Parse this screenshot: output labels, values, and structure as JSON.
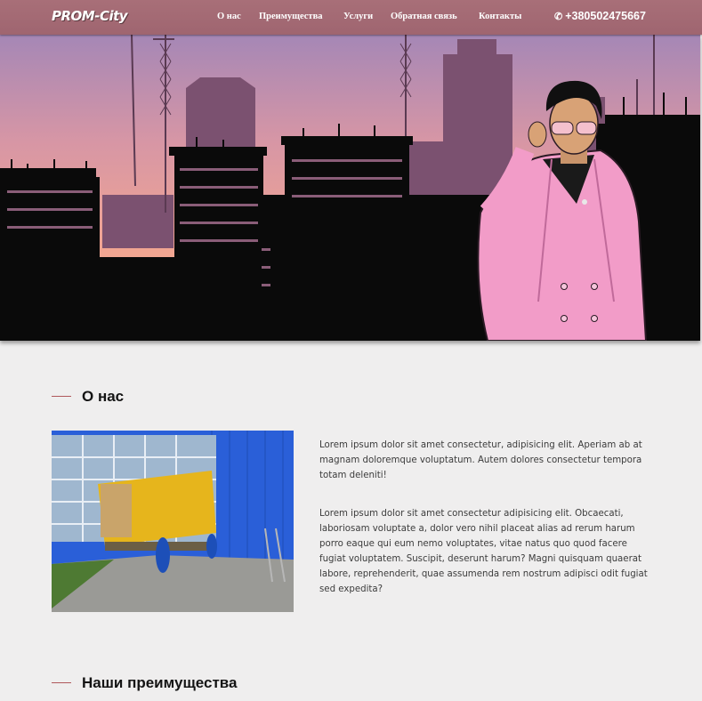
{
  "header": {
    "logo": "PROM-City",
    "nav": [
      {
        "label": "О нас"
      },
      {
        "label": "Преимущества"
      },
      {
        "label": "Услуги"
      },
      {
        "label": "Обратная связь"
      },
      {
        "label": "Контакты"
      }
    ],
    "phone": "+380502475667",
    "phone_icon": "phone-icon"
  },
  "hero": {
    "image": "Vice City style construction skyline with man in pink suit"
  },
  "about": {
    "title": "О нас",
    "paragraph1": "Lorem ipsum dolor sit amet consectetur, adipisicing elit. Aperiam ab at magnam doloremque voluptatum. Autem dolores consectetur tempora totam deleniti!",
    "paragraph2": "Lorem ipsum dolor sit amet consectetur adipisicing elit. Obcaecati, laboriosam voluptate a, dolor vero nihil placeat alias ad rerum harum porro eaque qui eum nemo voluptates, vitae natus quo quod facere fugiat voluptatem. Suscipit, deserunt harum? Magni quisquam quaerat labore, reprehenderit, quae assumenda rem nostrum adipisci odit fugiat sed expedita?"
  },
  "advantages": {
    "title": "Наши преимущества"
  },
  "colors": {
    "header": "#a36a74",
    "accent_dash": "#b0585c",
    "background": "#efeeee"
  }
}
